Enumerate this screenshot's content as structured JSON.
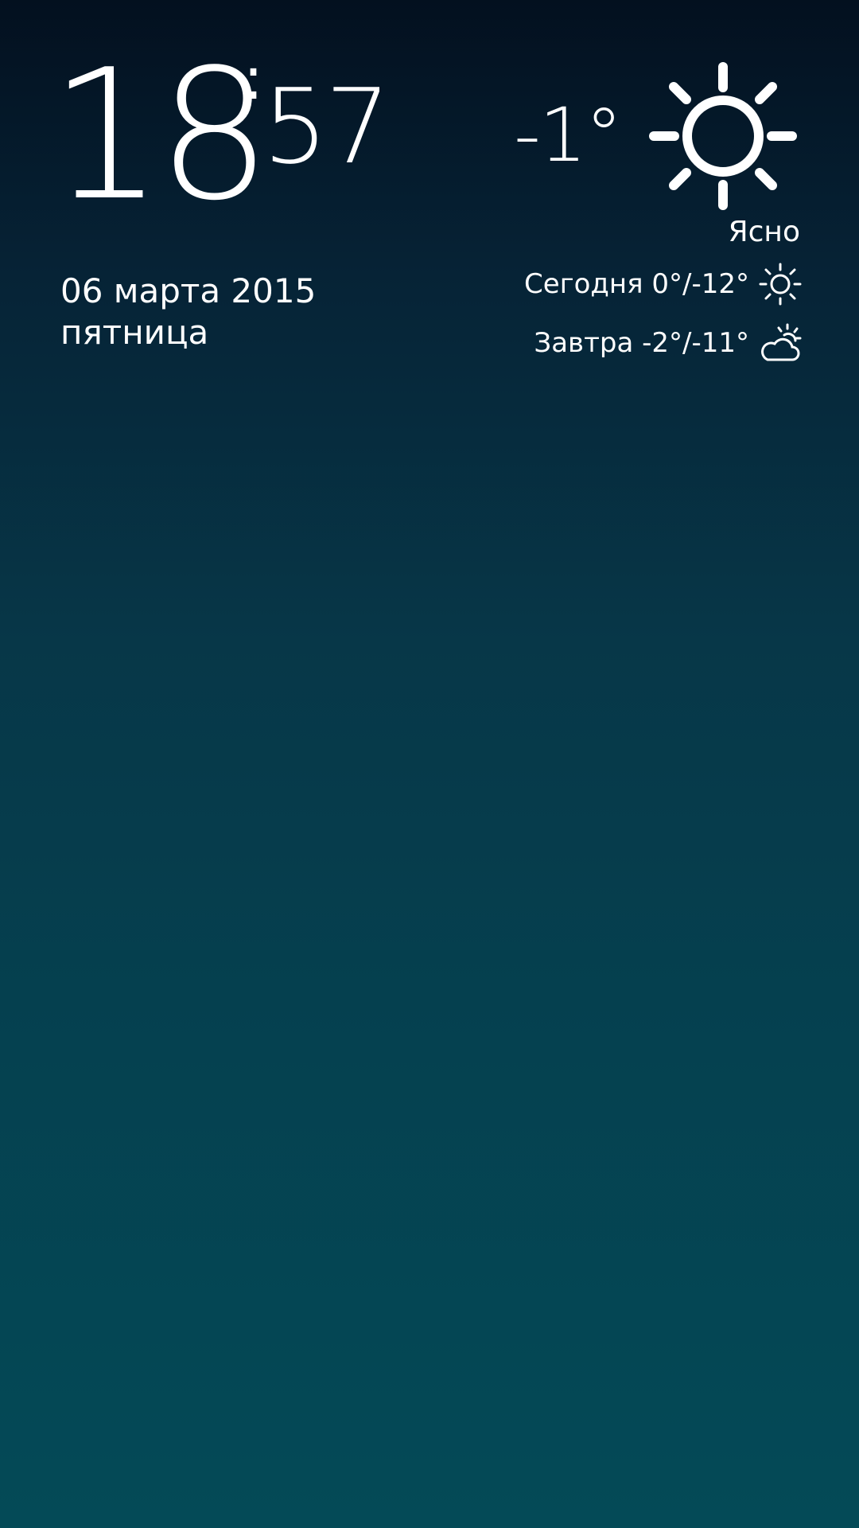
{
  "clock": {
    "hours": "18",
    "colon": ":",
    "minutes": "57"
  },
  "date": {
    "date_line": "06 марта 2015",
    "weekday": "пятница"
  },
  "weather": {
    "current_temp": "-1°",
    "condition": "Ясно",
    "current_icon": "sun-icon",
    "forecast": [
      {
        "text": "Сегодня 0°/-12°",
        "icon": "sun-icon"
      },
      {
        "text": "Завтра -2°/-11°",
        "icon": "partly-cloudy-icon"
      }
    ]
  },
  "colors": {
    "text": "#ffffff",
    "background_top": "#03101f",
    "background_bottom": "#044a57"
  }
}
